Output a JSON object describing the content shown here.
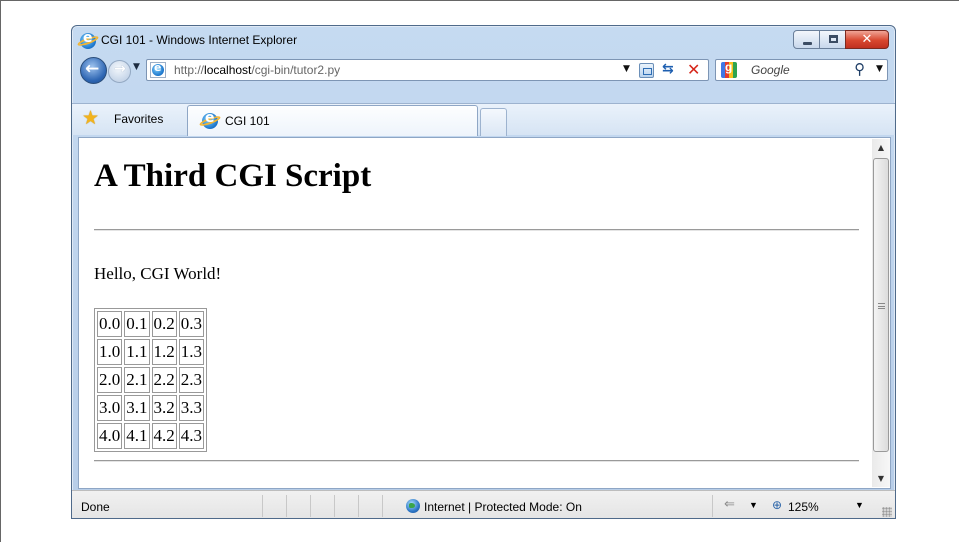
{
  "window": {
    "title": "CGI 101 - Windows Internet Explorer",
    "controls": {
      "minimize": "minimize",
      "maximize": "maximize",
      "close": "✕"
    }
  },
  "navigation": {
    "back_icon": "back-arrow-icon",
    "forward_icon": "forward-arrow-icon",
    "url_prefix": "http://",
    "url_host": "localhost",
    "url_path": "/cgi-bin/tutor2.py",
    "search_placeholder": "Google"
  },
  "tabs": {
    "favorites_label": "Favorites",
    "items": [
      {
        "label": "CGI 101",
        "active": true
      }
    ]
  },
  "page": {
    "heading": "A Third CGI Script",
    "greeting": "Hello, CGI World!",
    "table": [
      [
        "0.0",
        "0.1",
        "0.2",
        "0.3"
      ],
      [
        "1.0",
        "1.1",
        "1.2",
        "1.3"
      ],
      [
        "2.0",
        "2.1",
        "2.2",
        "2.3"
      ],
      [
        "3.0",
        "3.1",
        "3.2",
        "3.3"
      ],
      [
        "4.0",
        "4.1",
        "4.2",
        "4.3"
      ]
    ]
  },
  "status": {
    "text": "Done",
    "zone": "Internet | Protected Mode: On",
    "zoom": "125%"
  }
}
